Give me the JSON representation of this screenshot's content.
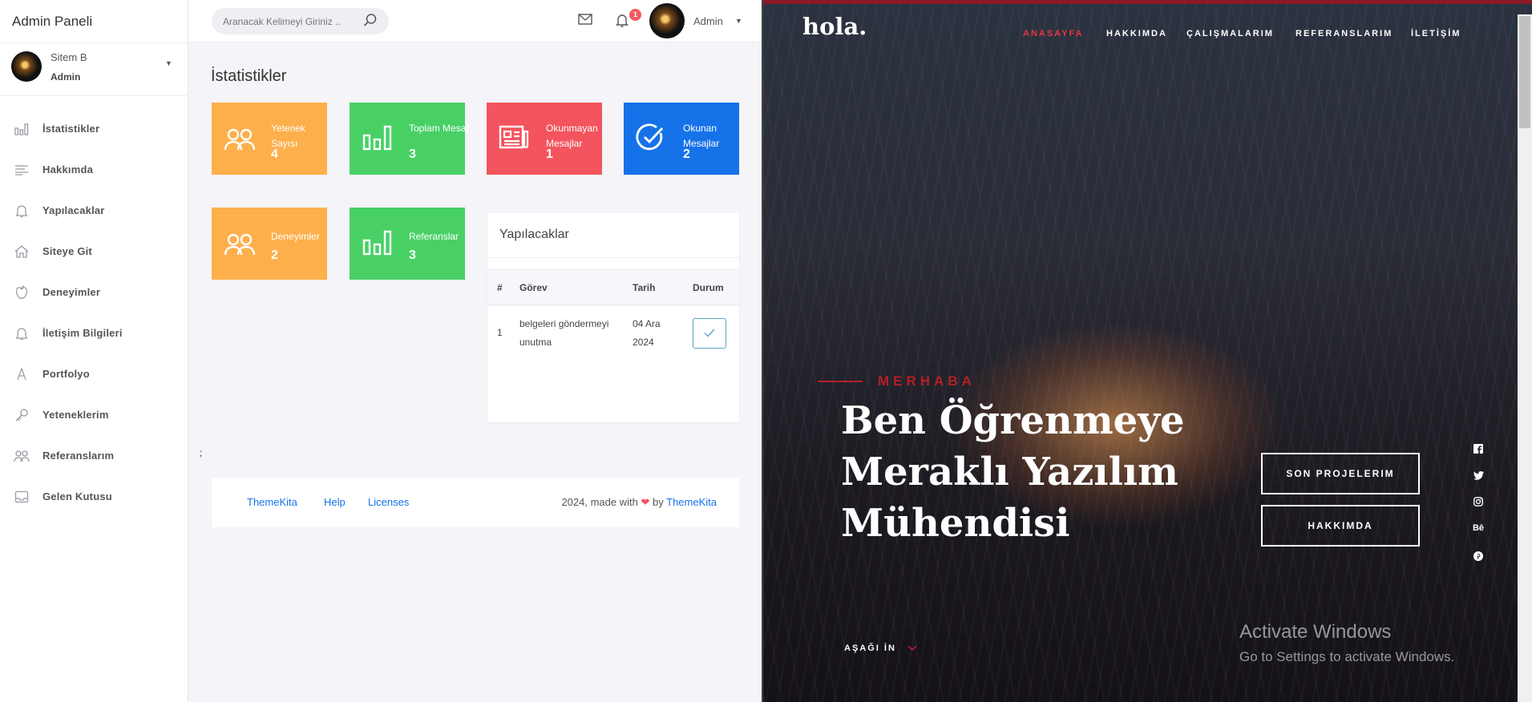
{
  "admin": {
    "brand": "Admin Paneli",
    "user": {
      "name": "Sitem B",
      "role": "Admin"
    },
    "nav": [
      {
        "label": "İstatistikler"
      },
      {
        "label": "Hakkımda"
      },
      {
        "label": "Yapılacaklar"
      },
      {
        "label": "Siteye Git"
      },
      {
        "label": "Deneyimler"
      },
      {
        "label": "İletişim Bilgileri"
      },
      {
        "label": "Portfolyo"
      },
      {
        "label": "Yeteneklerim"
      },
      {
        "label": "Referanslarım"
      },
      {
        "label": "Gelen Kutusu"
      }
    ],
    "search_placeholder": "Aranacak Kelimeyi Giriniz ..",
    "notification_count": "1",
    "top_user": "Admin",
    "page_title": "İstatistikler",
    "stats": [
      {
        "label": "Yetenek Sayısı",
        "value": "4",
        "color": "#fdaf4b"
      },
      {
        "label": "Toplam Mesaj",
        "value": "3",
        "color": "#48d065"
      },
      {
        "label": "Okunmayan Mesajlar",
        "value": "1",
        "color": "#f3545d"
      },
      {
        "label": "Okunan Mesajlar",
        "value": "2",
        "color": "#1572e8"
      },
      {
        "label": "Deneyimler",
        "value": "2",
        "color": "#fdaf4b"
      },
      {
        "label": "Referanslar",
        "value": "3",
        "color": "#48d065"
      }
    ],
    "todo": {
      "title": "Yapılacaklar",
      "headers": [
        "#",
        "Görev",
        "Tarih",
        "Durum"
      ],
      "rows": [
        {
          "no": "1",
          "task": "belgeleri göndermeyi unutma",
          "date": "04 Ara 2024"
        }
      ]
    },
    "stray_text": ";",
    "footer": {
      "links": [
        "ThemeKita",
        "Help",
        "Licenses"
      ],
      "made_with": "2024, made with",
      "by": "by",
      "author": "ThemeKita"
    }
  },
  "site": {
    "logo": "hola.",
    "nav": [
      "ANASAYFA",
      "HAKKIMDA",
      "ÇALIŞMALARIM",
      "REFERANSLARIM",
      "İLETİŞİM"
    ],
    "kicker": "MERHABA",
    "headline": "Ben Öğrenmeye Meraklı Yazılım Mühendisi",
    "buttons": [
      "SON PROJELERIM",
      "HAKKIMDA"
    ],
    "social": [
      "facebook-icon",
      "twitter-icon",
      "instagram-icon",
      "behance-icon",
      "pinterest-icon"
    ],
    "behance_text": "Bē",
    "scroll_down": "AŞAĞI İN",
    "watermark": {
      "title": "Activate Windows",
      "subtitle": "Go to Settings to activate Windows."
    }
  },
  "colors": {
    "accent_red": "#b61f28",
    "primary_blue": "#1572e8"
  }
}
